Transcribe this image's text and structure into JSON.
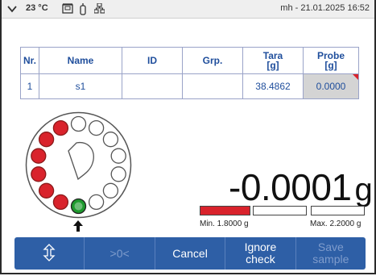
{
  "status": {
    "temperature": "23 °C",
    "user_datetime": "mh - 21.01.2025 16:52",
    "icons": [
      "chevron-down-icon",
      "clipboard-icon",
      "balance-icon",
      "network-icon"
    ]
  },
  "table": {
    "headers": [
      {
        "line1": "Nr.",
        "line2": ""
      },
      {
        "line1": "Name",
        "line2": ""
      },
      {
        "line1": "ID",
        "line2": ""
      },
      {
        "line1": "Grp.",
        "line2": ""
      },
      {
        "line1": "Tara",
        "line2": "[g]"
      },
      {
        "line1": "Probe",
        "line2": "[g]"
      }
    ],
    "rows": [
      {
        "nr": "1",
        "name": "s1",
        "id": "",
        "grp": "",
        "tara": "38.4862",
        "probe": "0.0000"
      }
    ]
  },
  "carousel": {
    "positions": 14,
    "red_positions": 6,
    "active_position_color": "green"
  },
  "reading": {
    "value": "-0.0001",
    "unit": "g"
  },
  "tolerance": {
    "min_label": "Min. 1.8000 g",
    "max_label": "Max. 2.2000 g",
    "segments_filled": 1,
    "segments_total": 3
  },
  "buttons": {
    "swap_icon": "up-down-arrow-icon",
    "zero": ">0<",
    "cancel": "Cancel",
    "ignore_line1": "Ignore",
    "ignore_line2": "check",
    "save_line1": "Save",
    "save_line2": "sample"
  },
  "colors": {
    "accent": "#2e5fa6",
    "table_text": "#1f4e9c",
    "red": "#d9232c",
    "green": "#1e9a2e"
  }
}
